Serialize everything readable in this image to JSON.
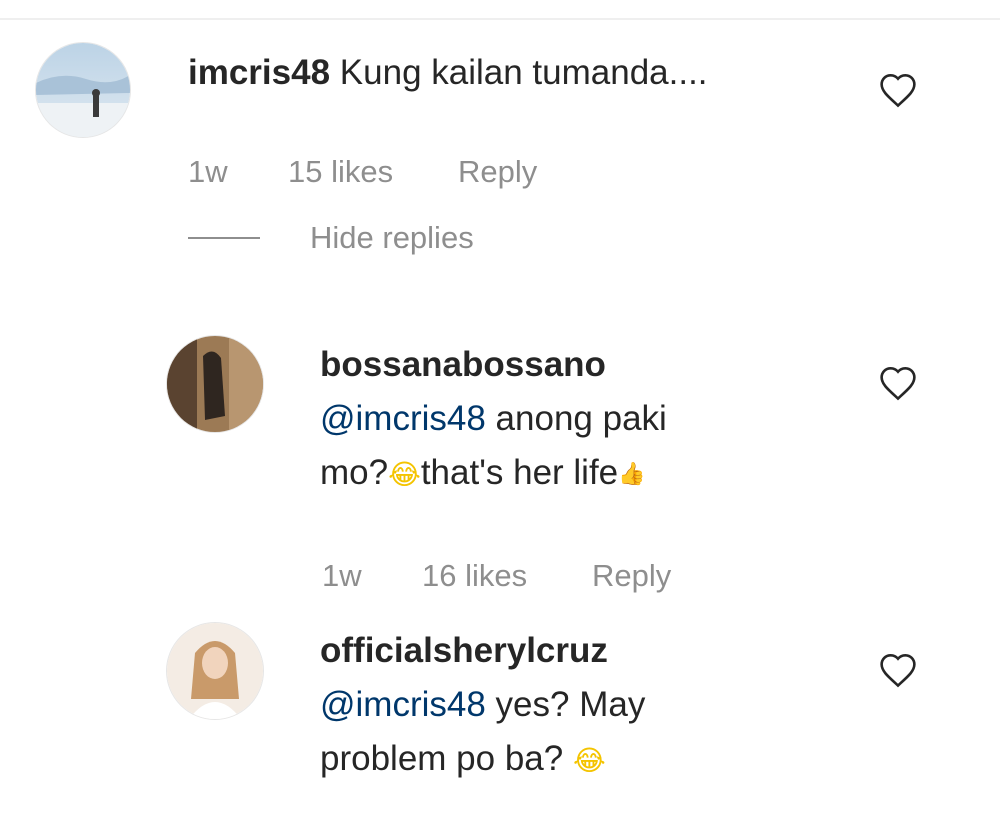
{
  "comments": [
    {
      "username": "imcris48",
      "text": "Kung kailan tumanda....",
      "time": "1w",
      "likes": "15 likes",
      "reply_label": "Reply",
      "hide_replies_label": "Hide replies"
    }
  ],
  "replies": [
    {
      "username": "bossanabossano",
      "mention": "@imcris48",
      "text_line1_rest": " anong paki",
      "text_line2_start": "mo?",
      "emoji": "😂",
      "text_line2_end": "that's her life",
      "thumb": "👍",
      "time": "1w",
      "likes": "16 likes",
      "reply_label": "Reply"
    },
    {
      "username": "officialsherylcruz",
      "mention": "@imcris48",
      "text_line1_rest": " yes? May",
      "text_line2": "problem po ba? ",
      "emoji": "😂"
    }
  ],
  "icons": {
    "like": "heart-outline-icon"
  },
  "colors": {
    "text": "#262626",
    "secondary": "#8e8e8e",
    "mention": "#00376b"
  }
}
